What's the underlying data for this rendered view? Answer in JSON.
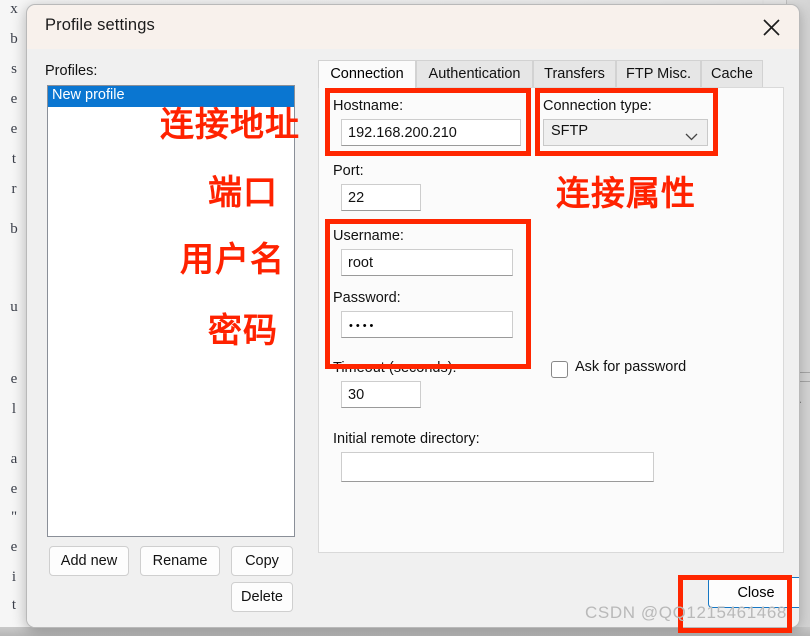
{
  "window": {
    "title": "Profile settings",
    "close_icon": "close-x-icon"
  },
  "profiles": {
    "label": "Profiles:",
    "items": [
      {
        "name": "New profile",
        "selected": true
      }
    ],
    "buttons": {
      "add_new": "Add new",
      "rename": "Rename",
      "copy": "Copy",
      "delete": "Delete"
    }
  },
  "tabs": [
    {
      "label": "Connection",
      "active": true
    },
    {
      "label": "Authentication",
      "active": false
    },
    {
      "label": "Transfers",
      "active": false
    },
    {
      "label": "FTP Misc.",
      "active": false
    },
    {
      "label": "Cache",
      "active": false
    }
  ],
  "connection": {
    "hostname": {
      "label": "Hostname:",
      "value": "192.168.200.210",
      "placeholder": ""
    },
    "connection_type": {
      "label": "Connection type:",
      "value": "SFTP",
      "arrow_icon": "chevron-down-icon"
    },
    "port": {
      "label": "Port:",
      "value": "22",
      "placeholder": ""
    },
    "username": {
      "label": "Username:",
      "value": "root",
      "placeholder": ""
    },
    "password": {
      "label": "Password:",
      "value": "••••",
      "masked_char_count": 4,
      "placeholder": ""
    },
    "ask_for_password": {
      "label": "Ask for password",
      "checked": false
    },
    "timeout": {
      "label": "Timeout (seconds):",
      "value": "30",
      "placeholder": ""
    },
    "initial_remote_directory": {
      "label": "Initial remote directory:",
      "value": "",
      "placeholder": ""
    }
  },
  "footer": {
    "close_button": "Close"
  },
  "annotations": {
    "accent_color": "#ff2200",
    "labels": [
      {
        "text": "连接地址",
        "meaning": "connection-address"
      },
      {
        "text": "端口",
        "meaning": "port"
      },
      {
        "text": "用户名",
        "meaning": "username"
      },
      {
        "text": "密码",
        "meaning": "password"
      },
      {
        "text": "连接属性",
        "meaning": "connection-properties"
      }
    ]
  },
  "watermark": {
    "text": "CSDN @QQ1215461468"
  },
  "background": {
    "left_text_fragments": [
      "x",
      "b",
      "s",
      "e",
      "e",
      "t",
      "r",
      "b",
      "u",
      "e",
      "l",
      "a",
      "e",
      "\"",
      "e",
      "i",
      "t"
    ]
  }
}
